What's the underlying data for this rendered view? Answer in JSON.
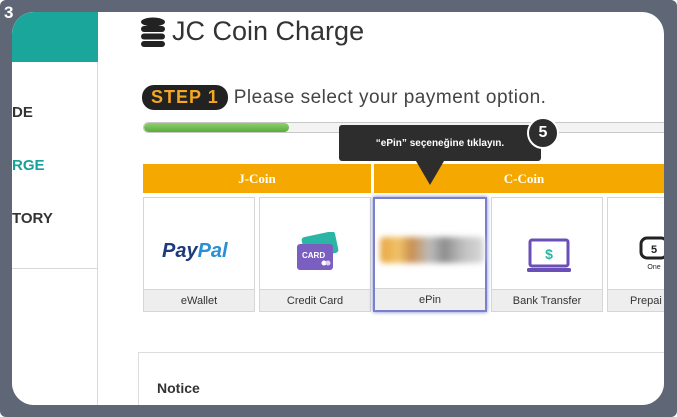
{
  "step_number": "3",
  "sidebar": {
    "items": [
      {
        "label": "DE",
        "active": false
      },
      {
        "label": "RGE",
        "active": true
      },
      {
        "label": "TORY",
        "active": false
      }
    ]
  },
  "header": {
    "title": "JC Coin Charge"
  },
  "step": {
    "badge": "STEP 1",
    "text": "Please select your payment option.",
    "progress": 0.27
  },
  "tabs": [
    {
      "label": "J-Coin"
    },
    {
      "label": "C-Coin"
    }
  ],
  "payment_options": [
    {
      "label": "eWallet",
      "icon": "paypal-logo",
      "logo_text_dark": "Pay",
      "logo_text_light": "Pal"
    },
    {
      "label": "Credit Card",
      "icon": "credit-card-icon",
      "icon_text": "CARD"
    },
    {
      "label": "ePin",
      "icon": "epin-image",
      "selected": true
    },
    {
      "label": "Bank Transfer",
      "icon": "bank-transfer-icon",
      "icon_text": "$"
    },
    {
      "label": "Prepai",
      "icon": "prepaid-icon",
      "icon_text": "One"
    }
  ],
  "tooltip": {
    "badge": "5",
    "text": "“ePin” seçeneğine tıklayın."
  },
  "notice": {
    "title": "Notice"
  },
  "colors": {
    "accent_teal": "#1aa69a",
    "tab_orange": "#f5a800",
    "step_badge_text": "#f5a623",
    "progress_green": "#5bab3c",
    "frame_gray": "#5f6675",
    "selected_border": "#7b80cc"
  }
}
